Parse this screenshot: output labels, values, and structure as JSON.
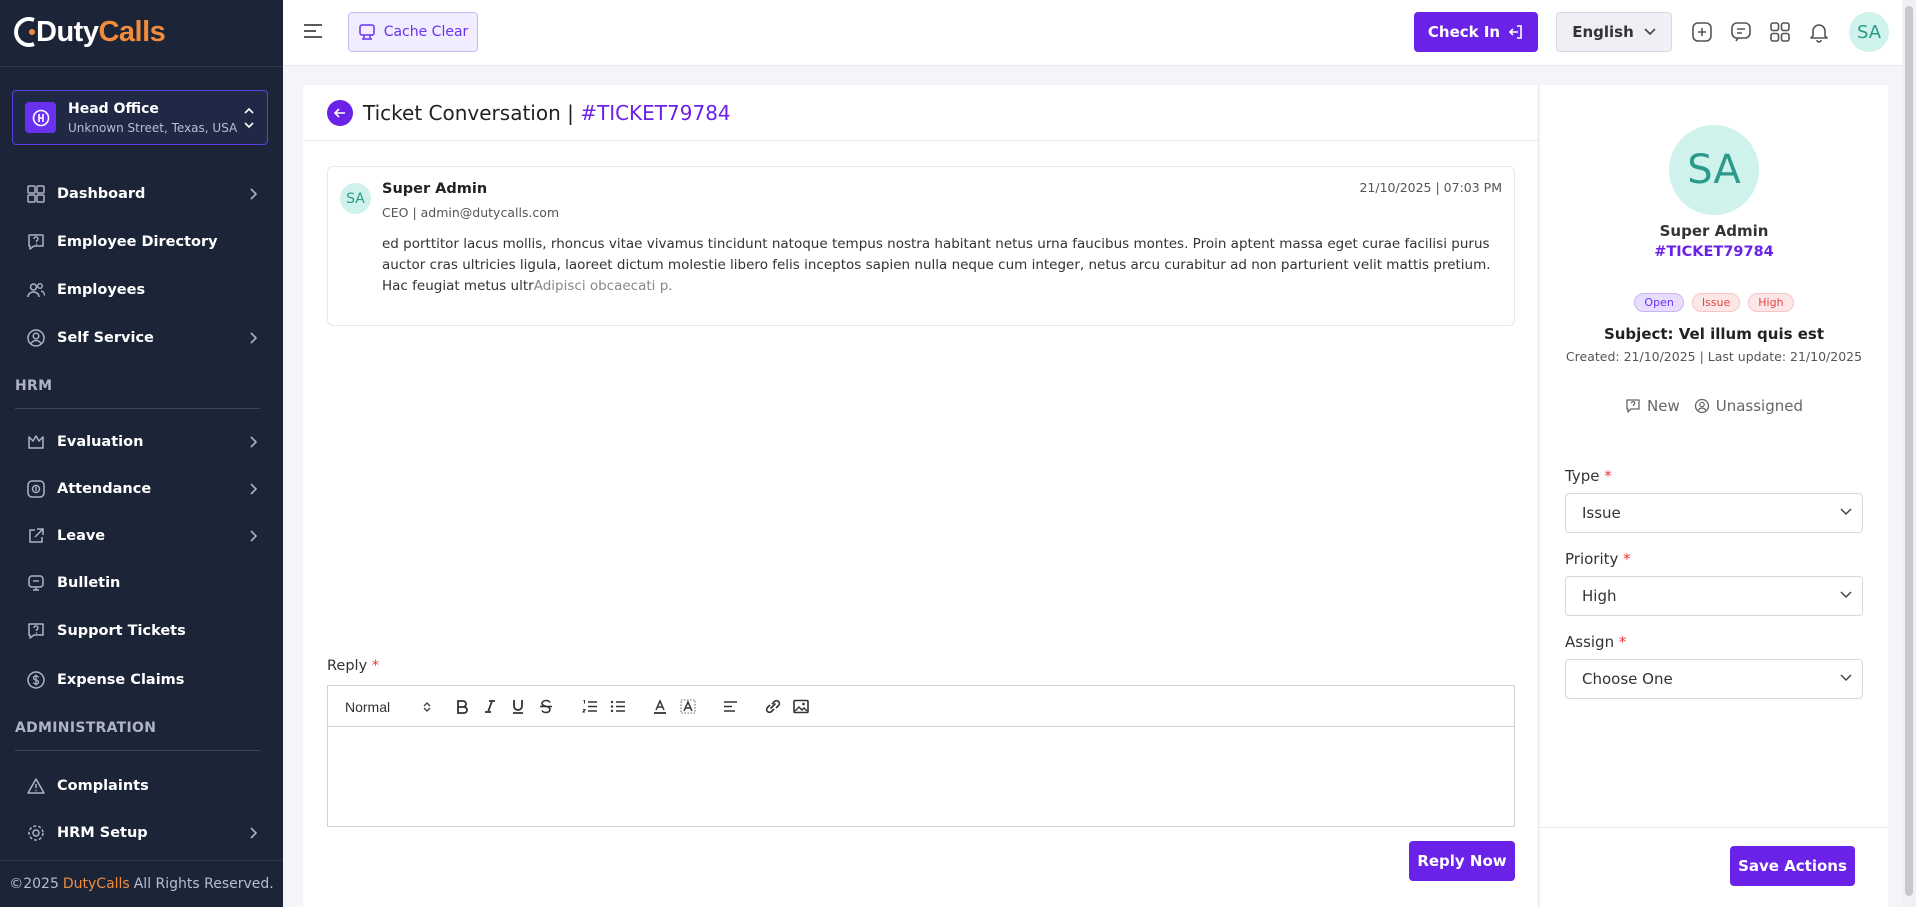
{
  "brand": {
    "logo_part1": "Duty",
    "logo_part2": "Calls",
    "accent": "#6a22e8",
    "orange": "#f08c3a"
  },
  "office": {
    "name": "Head Office",
    "address": "Unknown Street, Texas, USA"
  },
  "sidebar": {
    "items": [
      {
        "label": "Dashboard",
        "icon": "grid-icon",
        "arrow": true
      },
      {
        "label": "Employee Directory",
        "icon": "help-bubble-icon",
        "arrow": false
      },
      {
        "label": "Employees",
        "icon": "users-icon",
        "arrow": false
      },
      {
        "label": "Self Service",
        "icon": "user-circle-icon",
        "arrow": true
      }
    ],
    "section_hrm": "HRM",
    "hrm_items": [
      {
        "label": "Evaluation",
        "icon": "crown-icon",
        "arrow": true
      },
      {
        "label": "Attendance",
        "icon": "fingerprint-icon",
        "arrow": true
      },
      {
        "label": "Leave",
        "icon": "external-icon",
        "arrow": true
      },
      {
        "label": "Bulletin",
        "icon": "megaphone-icon",
        "arrow": false
      },
      {
        "label": "Support Tickets",
        "icon": "help-bubble-icon",
        "arrow": false
      },
      {
        "label": "Expense Claims",
        "icon": "dollar-icon",
        "arrow": false
      }
    ],
    "section_admin": "ADMINISTRATION",
    "admin_items": [
      {
        "label": "Complaints",
        "icon": "alert-triangle-icon",
        "arrow": false
      },
      {
        "label": "HRM Setup",
        "icon": "gear-icon",
        "arrow": true
      }
    ],
    "footer_prefix": "©2025",
    "footer_brand": "DutyCalls",
    "footer_suffix": "All Rights Reserved."
  },
  "topbar": {
    "cache_label": "Cache Clear",
    "checkin_label": "Check In",
    "language": "English",
    "avatar_initials": "SA"
  },
  "page": {
    "title": "Ticket Conversation |",
    "ticket_id": "#TICKET79784"
  },
  "message": {
    "avatar": "SA",
    "author": "Super Admin",
    "role_email": "CEO | admin@dutycalls.com",
    "timestamp": "21/10/2025 | 07:03 PM",
    "body": "ed porttitor lacus mollis, rhoncus vitae vivamus tincidunt natoque tempus nostra habitant netus urna faucibus montes. Proin aptent massa eget curae facilisi purus auctor cras ultricies ligula, laoreet dictum molestie libero felis inceptos sapien nulla neque cum integer, netus arcu curabitur ad non parturient velit mattis pretium. Hac feugiat metus ultr",
    "body_faded": "Adipisci obcaecati p."
  },
  "reply": {
    "label": "Reply",
    "required_mark": "*",
    "format": "Normal",
    "submit_label": "Reply Now"
  },
  "panel": {
    "avatar": "SA",
    "name": "Super Admin",
    "ticket_id": "#TICKET79784",
    "badges": {
      "status": "Open",
      "type": "Issue",
      "priority": "High"
    },
    "subject": "Subject: Vel illum quis est",
    "dates": "Created: 21/10/2025 | Last update: 21/10/2025",
    "state": "New",
    "assignee": "Unassigned",
    "type_label": "Type",
    "type_value": "Issue",
    "priority_label": "Priority",
    "priority_value": "High",
    "assign_label": "Assign",
    "assign_value": "Choose One",
    "save_label": "Save Actions"
  }
}
